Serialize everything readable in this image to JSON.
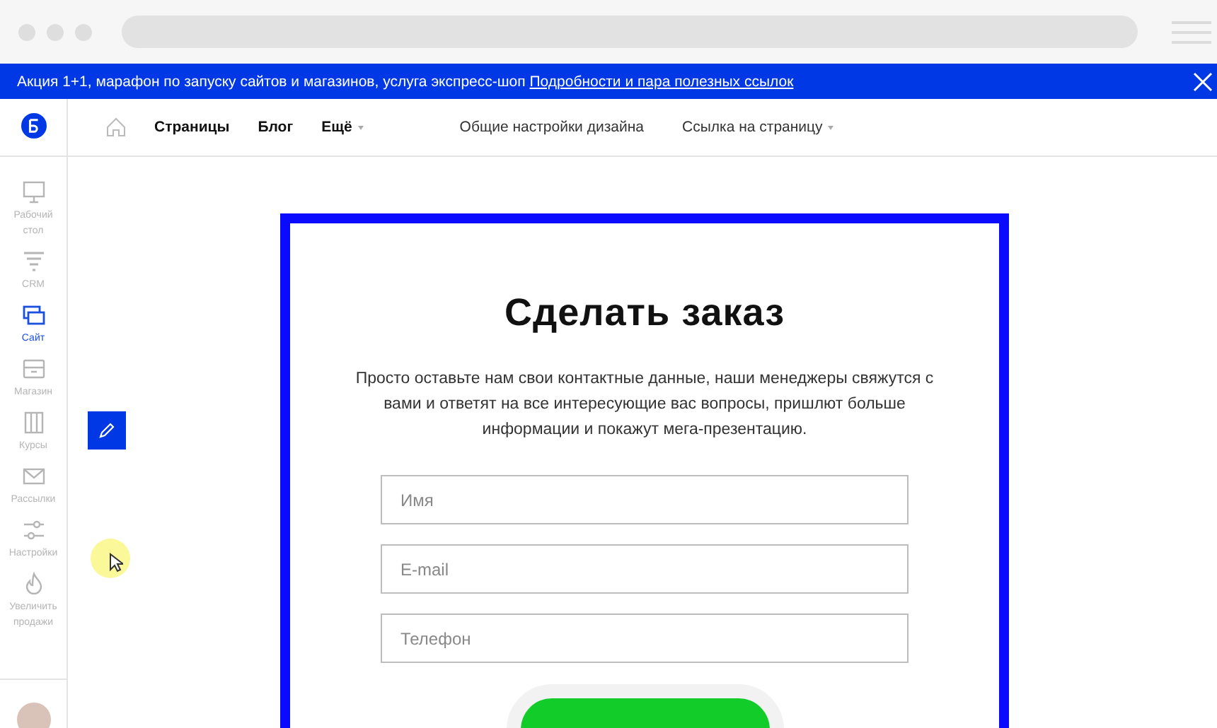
{
  "banner": {
    "text": "Акция 1+1, марафон по запуску сайтов и магазинов, услуга экспресс-шоп",
    "link": "Подробности и пара полезных ссылок"
  },
  "nav": {
    "left": [
      {
        "label": "Страницы",
        "dropdown": false
      },
      {
        "label": "Блог",
        "dropdown": false
      },
      {
        "label": "Ещё",
        "dropdown": true
      }
    ],
    "right": [
      {
        "label": "Общие настройки дизайна",
        "dropdown": false
      },
      {
        "label": "Ссылка на страницу",
        "dropdown": true
      }
    ]
  },
  "sidebar": {
    "items": [
      {
        "kind": "desktop",
        "label": "Рабочий стол",
        "selected": false
      },
      {
        "kind": "crm",
        "label": "CRM",
        "selected": false
      },
      {
        "kind": "site",
        "label": "Сайт",
        "selected": true
      },
      {
        "kind": "shop",
        "label": "Магазин",
        "selected": false
      },
      {
        "kind": "courses",
        "label": "Курсы",
        "selected": false
      },
      {
        "kind": "mail",
        "label": "Рассылки",
        "selected": false
      },
      {
        "kind": "settings",
        "label": "Настройки",
        "selected": false
      },
      {
        "kind": "fire",
        "label": "Увеличить продажи",
        "selected": false
      }
    ]
  },
  "card": {
    "title": "Сделать заказ",
    "description": "Просто оставьте нам свои контактные данные, наши менеджеры свяжутся с вами и ответят на все интересующие вас вопросы, пришлют больше информации и покажут мега-презентацию.",
    "fields": [
      {
        "placeholder": "Имя"
      },
      {
        "placeholder": "E-mail"
      },
      {
        "placeholder": "Телефон"
      }
    ]
  }
}
